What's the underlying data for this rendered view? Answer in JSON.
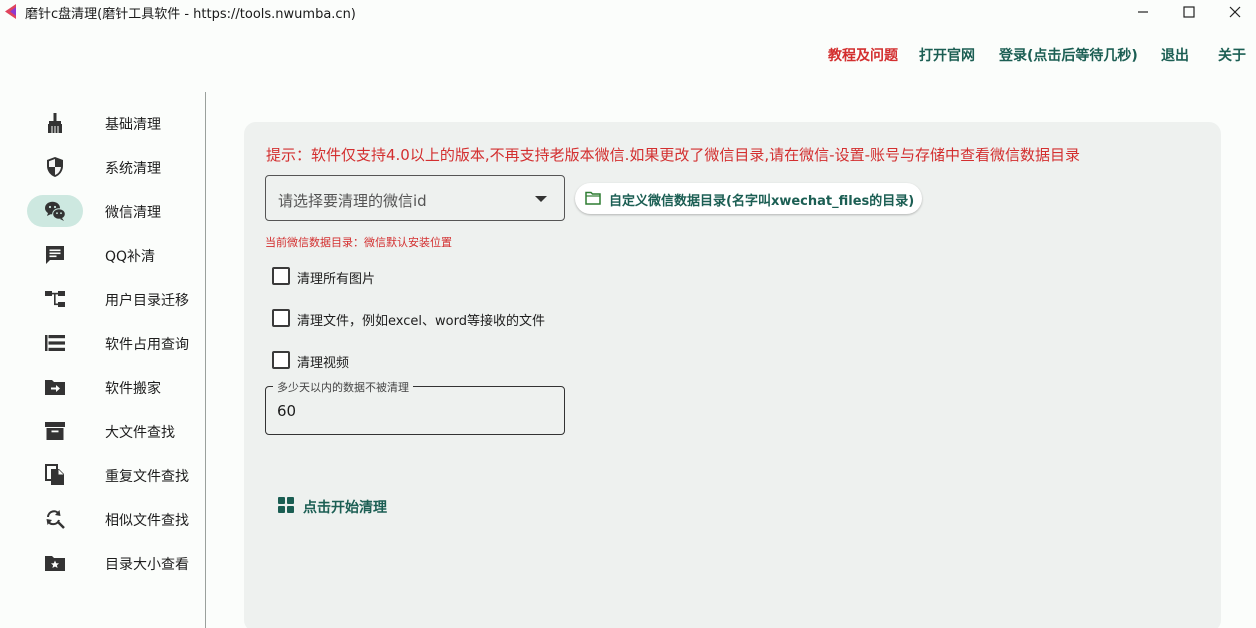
{
  "window": {
    "title": "磨针c盘清理(磨针工具软件 - https://tools.nwumba.cn)"
  },
  "topnav": {
    "help": "教程及问题",
    "official_site": "打开官网",
    "login": "登录(点击后等待几秒)",
    "logout": "退出",
    "about": "关于"
  },
  "sidebar": {
    "items": [
      {
        "label": "基础清理",
        "icon": "broom-icon"
      },
      {
        "label": "系统清理",
        "icon": "shield-icon"
      },
      {
        "label": "微信清理",
        "icon": "wechat-icon",
        "active": true
      },
      {
        "label": "QQ补清",
        "icon": "chat-icon"
      },
      {
        "label": "用户目录迁移",
        "icon": "tree-icon"
      },
      {
        "label": "软件占用查询",
        "icon": "list-icon"
      },
      {
        "label": "软件搬家",
        "icon": "folder-move-icon"
      },
      {
        "label": "大文件查找",
        "icon": "archive-icon"
      },
      {
        "label": "重复文件查找",
        "icon": "duplicate-file-icon"
      },
      {
        "label": "相似文件查找",
        "icon": "search-refresh-icon"
      },
      {
        "label": "目录大小查看",
        "icon": "folder-star-icon"
      }
    ]
  },
  "main": {
    "hint": "提示：软件仅支持4.0以上的版本,不再支持老版本微信.如果更改了微信目录,请在微信-设置-账号与存储中查看微信数据目录",
    "select_placeholder": "请选择要清理的微信id",
    "custom_dir_button": "自定义微信数据目录(名字叫xwechat_files的目录)",
    "current_dir": "当前微信数据目录：微信默认安装位置",
    "checkboxes": [
      {
        "label": "清理所有图片",
        "checked": false
      },
      {
        "label": "清理文件，例如excel、word等接收的文件",
        "checked": false
      },
      {
        "label": "清理视频",
        "checked": false
      }
    ],
    "days_label": "多少天以内的数据不被清理",
    "days_value": "60",
    "start_button": "点击开始清理"
  },
  "colors": {
    "accent": "#1b5e53",
    "warning": "#d32f2f",
    "active_pill": "#cde8e0",
    "panel_bg": "#eef1ef"
  }
}
